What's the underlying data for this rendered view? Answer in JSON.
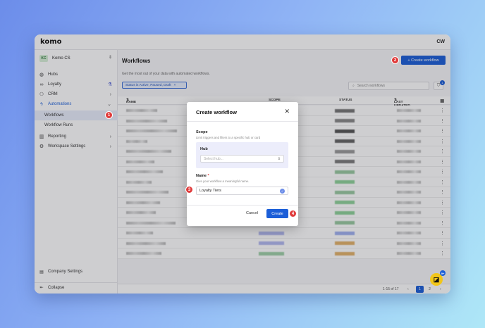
{
  "app": {
    "logo": "komo",
    "user_initials": "CW"
  },
  "workspace": {
    "initials": "KC",
    "name": "Komo CS"
  },
  "sidebar": {
    "items": [
      {
        "label": "Hubs",
        "icon": "globe-icon"
      },
      {
        "label": "Loyalty",
        "icon": "link-icon"
      },
      {
        "label": "CRM",
        "icon": "users-icon"
      },
      {
        "label": "Automations",
        "icon": "bolt-icon"
      },
      {
        "label": "Workflows"
      },
      {
        "label": "Workflow Runs"
      },
      {
        "label": "Reporting",
        "icon": "chart-icon"
      },
      {
        "label": "Workspace Settings",
        "icon": "gear-icon"
      }
    ],
    "company_settings": "Company Settings",
    "collapse": "Collapse"
  },
  "page": {
    "title": "Workflows",
    "description": "Get the most out of your data with automated workflows.",
    "create_button": "+ Create workflow",
    "filter_chip": "Status is Active, Paused, Draft",
    "search_placeholder": "Search workflows",
    "filter_count": "1"
  },
  "table": {
    "headers": {
      "name": "NAME",
      "scope": "SCOPE",
      "status": "STATUS",
      "updated": "LAST UPDATED"
    },
    "row_count": 17
  },
  "pagination": {
    "range": "1-15 of 17",
    "pages": [
      "1",
      "2"
    ]
  },
  "modal": {
    "title": "Create workflow",
    "scope_label": "Scope",
    "scope_hint": "Limit triggers and filters to a specific hub or card",
    "hub_label": "Hub",
    "hub_placeholder": "Select hub...",
    "name_label": "Name",
    "name_required": "*",
    "name_hint": "Give your workflow a meaningful name.",
    "name_value": "Loyalty Tiers",
    "cancel": "Cancel",
    "create": "Create"
  },
  "steps": [
    "1",
    "2",
    "3",
    "4"
  ],
  "colors": {
    "accent": "#1b5ed8",
    "step_badge": "#e03a3a",
    "help": "#f2c619"
  }
}
